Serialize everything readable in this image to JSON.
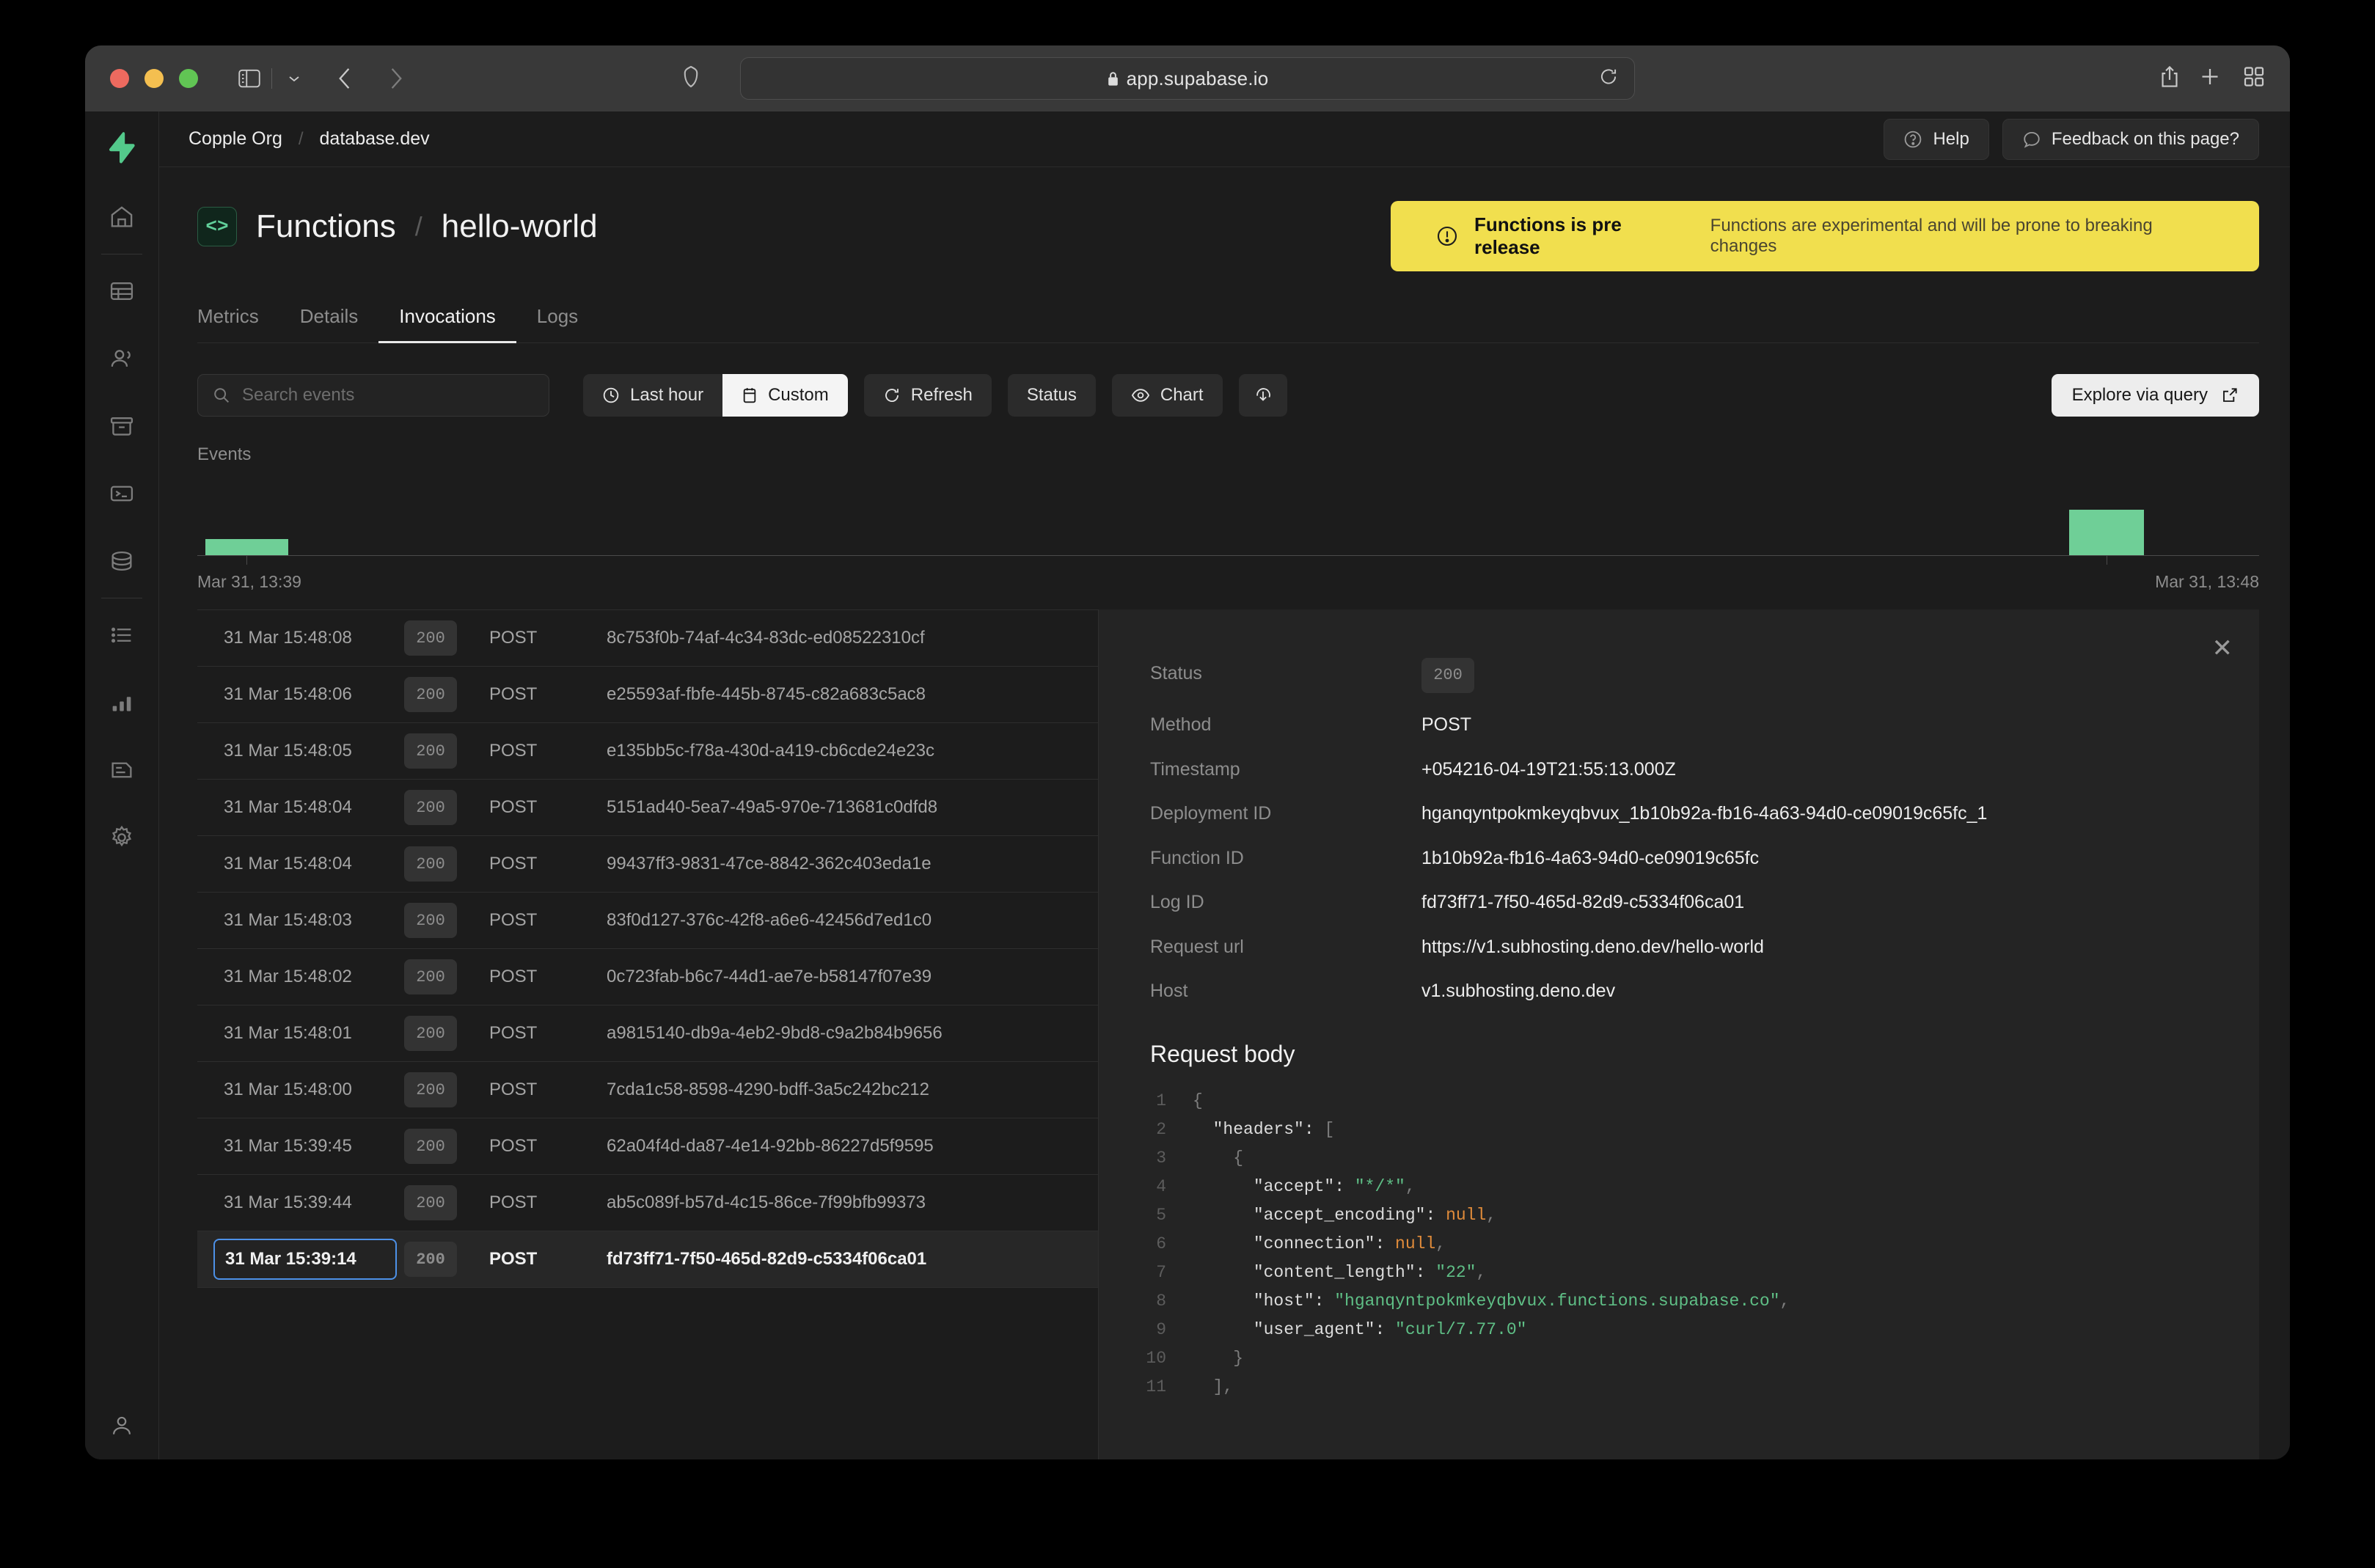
{
  "browser": {
    "url": "app.supabase.io",
    "lock_icon": "lock-icon",
    "sidebar_toggle_icon": "sidebar-toggle-icon",
    "back_icon": "back-arrow-icon",
    "forward_icon": "forward-arrow-icon",
    "shield_icon": "privacy-shield-icon",
    "reload_icon": "reload-icon",
    "share_icon": "share-icon",
    "new_tab_icon": "new-tab-icon",
    "tab-overview_icon": "tab-overview-icon"
  },
  "sidebar": {
    "logo": "supabase-logo",
    "items": [
      {
        "name": "home",
        "icon": "home-icon"
      },
      {
        "name": "table-editor",
        "icon": "table-icon"
      },
      {
        "name": "authentication",
        "icon": "users-icon"
      },
      {
        "name": "storage",
        "icon": "archive-icon"
      },
      {
        "name": "sql-editor",
        "icon": "terminal-icon"
      },
      {
        "name": "database",
        "icon": "database-icon"
      },
      {
        "name": "logs",
        "icon": "list-icon"
      },
      {
        "name": "reports",
        "icon": "bar-chart-icon"
      },
      {
        "name": "docs",
        "icon": "document-icon"
      },
      {
        "name": "settings",
        "icon": "gear-icon"
      }
    ],
    "account_icon": "user-avatar-icon"
  },
  "topbar": {
    "breadcrumb": {
      "org": "Copple Org",
      "separator": "/",
      "project": "database.dev"
    },
    "help_label": "Help",
    "help_icon": "question-circle-icon",
    "feedback_label": "Feedback on this page?",
    "feedback_icon": "chat-bubble-icon"
  },
  "page": {
    "badge_icon": "code-brackets-icon",
    "section": "Functions",
    "separator": "/",
    "function_name": "hello-world"
  },
  "banner": {
    "icon": "alert-circle-icon",
    "title": "Functions is pre release",
    "description": "Functions are experimental and will be prone to breaking changes",
    "color": "#f1df4e"
  },
  "tabs": [
    {
      "label": "Metrics",
      "active": false
    },
    {
      "label": "Details",
      "active": false
    },
    {
      "label": "Invocations",
      "active": true
    },
    {
      "label": "Logs",
      "active": false
    }
  ],
  "toolbar": {
    "search_placeholder": "Search events",
    "search_value": "",
    "search_icon": "search-icon",
    "range_last_hour": "Last hour",
    "range_last_hour_icon": "clock-icon",
    "range_custom": "Custom",
    "range_custom_icon": "calendar-icon",
    "refresh_label": "Refresh",
    "refresh_icon": "refresh-icon",
    "status_label": "Status",
    "chart_label": "Chart",
    "chart_icon": "eye-icon",
    "download_icon": "download-icon",
    "explore_label": "Explore via query",
    "explore_icon": "external-link-icon"
  },
  "chart_data": {
    "type": "bar",
    "title": "Events",
    "xlabel": "",
    "ylabel": "",
    "x_axis_start": "Mar 31, 13:39",
    "x_axis_end": "Mar 31, 13:48",
    "categories": [
      "Mar 31, 13:39",
      "Mar 31, 13:48"
    ],
    "values": [
      3,
      11
    ],
    "bars": [
      {
        "label": "Mar 31, 13:39",
        "value": 3,
        "left_pct": 0.5,
        "width_pct": 3.8,
        "height_pct": 22
      },
      {
        "label": "Mar 31, 13:48",
        "value": 11,
        "left_pct": 90.8,
        "width_pct": 3.8,
        "height_pct": 62
      }
    ],
    "grid": false,
    "legend": "none",
    "color": "#6fcf97"
  },
  "log_table": {
    "columns": [
      "timestamp",
      "status",
      "method",
      "id"
    ],
    "rows": [
      {
        "timestamp": "31 Mar 15:48:08",
        "status": "200",
        "method": "POST",
        "id": "8c753f0b-74af-4c34-83dc-ed08522310cf",
        "selected": false
      },
      {
        "timestamp": "31 Mar 15:48:06",
        "status": "200",
        "method": "POST",
        "id": "e25593af-fbfe-445b-8745-c82a683c5ac8",
        "selected": false
      },
      {
        "timestamp": "31 Mar 15:48:05",
        "status": "200",
        "method": "POST",
        "id": "e135bb5c-f78a-430d-a419-cb6cde24e23c",
        "selected": false
      },
      {
        "timestamp": "31 Mar 15:48:04",
        "status": "200",
        "method": "POST",
        "id": "5151ad40-5ea7-49a5-970e-713681c0dfd8",
        "selected": false
      },
      {
        "timestamp": "31 Mar 15:48:04",
        "status": "200",
        "method": "POST",
        "id": "99437ff3-9831-47ce-8842-362c403eda1e",
        "selected": false
      },
      {
        "timestamp": "31 Mar 15:48:03",
        "status": "200",
        "method": "POST",
        "id": "83f0d127-376c-42f8-a6e6-42456d7ed1c0",
        "selected": false
      },
      {
        "timestamp": "31 Mar 15:48:02",
        "status": "200",
        "method": "POST",
        "id": "0c723fab-b6c7-44d1-ae7e-b58147f07e39",
        "selected": false
      },
      {
        "timestamp": "31 Mar 15:48:01",
        "status": "200",
        "method": "POST",
        "id": "a9815140-db9a-4eb2-9bd8-c9a2b84b9656",
        "selected": false
      },
      {
        "timestamp": "31 Mar 15:48:00",
        "status": "200",
        "method": "POST",
        "id": "7cda1c58-8598-4290-bdff-3a5c242bc212",
        "selected": false
      },
      {
        "timestamp": "31 Mar 15:39:45",
        "status": "200",
        "method": "POST",
        "id": "62a04f4d-da87-4e14-92bb-86227d5f9595",
        "selected": false
      },
      {
        "timestamp": "31 Mar 15:39:44",
        "status": "200",
        "method": "POST",
        "id": "ab5c089f-b57d-4c15-86ce-7f99bfb99373",
        "selected": false
      },
      {
        "timestamp": "31 Mar 15:39:14",
        "status": "200",
        "method": "POST",
        "id": "fd73ff71-7f50-465d-82d9-c5334f06ca01",
        "selected": true
      }
    ]
  },
  "detail": {
    "close_icon": "close-icon",
    "fields": [
      {
        "key": "Status",
        "value": "200",
        "type": "chip"
      },
      {
        "key": "Method",
        "value": "POST",
        "type": "text"
      },
      {
        "key": "Timestamp",
        "value": "+054216-04-19T21:55:13.000Z",
        "type": "text"
      },
      {
        "key": "Deployment ID",
        "value": "hganqyntpokmkeyqbvux_1b10b92a-fb16-4a63-94d0-ce09019c65fc_1",
        "type": "text"
      },
      {
        "key": "Function ID",
        "value": "1b10b92a-fb16-4a63-94d0-ce09019c65fc",
        "type": "text"
      },
      {
        "key": "Log ID",
        "value": "fd73ff71-7f50-465d-82d9-c5334f06ca01",
        "type": "text"
      },
      {
        "key": "Request url",
        "value": "https://v1.subhosting.deno.dev/hello-world",
        "type": "text"
      },
      {
        "key": "Host",
        "value": "v1.subhosting.deno.dev",
        "type": "text"
      }
    ],
    "request_body_title": "Request body",
    "code_lines": [
      {
        "n": "1",
        "segments": [
          {
            "t": "{",
            "c": "punct"
          }
        ]
      },
      {
        "n": "2",
        "segments": [
          {
            "t": "  \"headers\": ",
            "c": "plain"
          },
          {
            "t": "[",
            "c": "punct"
          }
        ]
      },
      {
        "n": "3",
        "segments": [
          {
            "t": "    ",
            "c": "plain"
          },
          {
            "t": "{",
            "c": "punct"
          }
        ]
      },
      {
        "n": "4",
        "segments": [
          {
            "t": "      \"accept\": ",
            "c": "plain"
          },
          {
            "t": "\"*/*\"",
            "c": "str"
          },
          {
            "t": ",",
            "c": "punct"
          }
        ]
      },
      {
        "n": "5",
        "segments": [
          {
            "t": "      \"accept_encoding\": ",
            "c": "plain"
          },
          {
            "t": "null",
            "c": "null"
          },
          {
            "t": ",",
            "c": "punct"
          }
        ]
      },
      {
        "n": "6",
        "segments": [
          {
            "t": "      \"connection\": ",
            "c": "plain"
          },
          {
            "t": "null",
            "c": "null"
          },
          {
            "t": ",",
            "c": "punct"
          }
        ]
      },
      {
        "n": "7",
        "segments": [
          {
            "t": "      \"content_length\": ",
            "c": "plain"
          },
          {
            "t": "\"22\"",
            "c": "str"
          },
          {
            "t": ",",
            "c": "punct"
          }
        ]
      },
      {
        "n": "8",
        "segments": [
          {
            "t": "      \"host\": ",
            "c": "plain"
          },
          {
            "t": "\"hganqyntpokmkeyqbvux.functions.supabase.co\"",
            "c": "str"
          },
          {
            "t": ",",
            "c": "punct"
          }
        ]
      },
      {
        "n": "9",
        "segments": [
          {
            "t": "      \"user_agent\": ",
            "c": "plain"
          },
          {
            "t": "\"curl/7.77.0\"",
            "c": "str"
          }
        ]
      },
      {
        "n": "10",
        "segments": [
          {
            "t": "    ",
            "c": "plain"
          },
          {
            "t": "}",
            "c": "punct"
          }
        ]
      },
      {
        "n": "11",
        "segments": [
          {
            "t": "  ",
            "c": "plain"
          },
          {
            "t": "],",
            "c": "punct"
          }
        ]
      }
    ]
  }
}
